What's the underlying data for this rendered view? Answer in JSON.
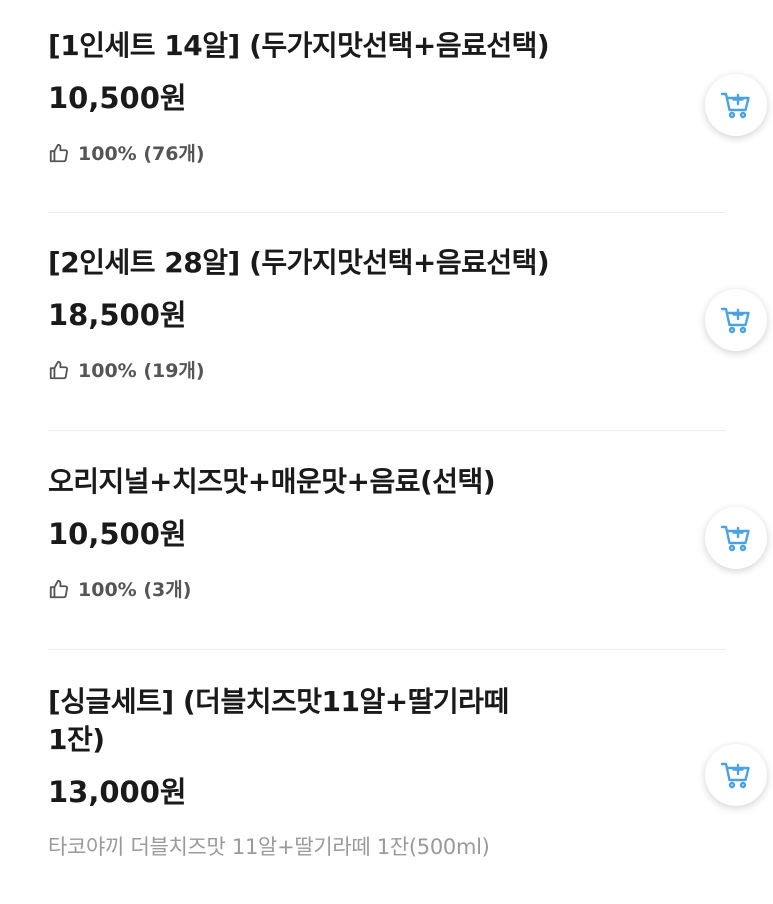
{
  "accent_color": "#4aa3e0",
  "menu": {
    "items": [
      {
        "name": "[1인세트 14알] (두가지맛선택+음료선택)",
        "price": "10,500원",
        "rating": "100% (76개)",
        "cart_icon": "add-to-cart-icon"
      },
      {
        "name": "[2인세트 28알] (두가지맛선택+음료선택)",
        "price": "18,500원",
        "rating": "100% (19개)",
        "cart_icon": "add-to-cart-icon"
      },
      {
        "name": "오리지널+치즈맛+매운맛+음료(선택)",
        "price": "10,500원",
        "rating": "100% (3개)",
        "cart_icon": "add-to-cart-icon"
      },
      {
        "name_line1": "[싱글세트] (더블치즈맛11알+딸기라떼",
        "name_line2": "1잔)",
        "price": "13,000원",
        "description": "타코야끼 더블치즈맛 11알+딸기라떼 1잔(500ml)",
        "cart_icon": "add-to-cart-icon"
      }
    ]
  }
}
